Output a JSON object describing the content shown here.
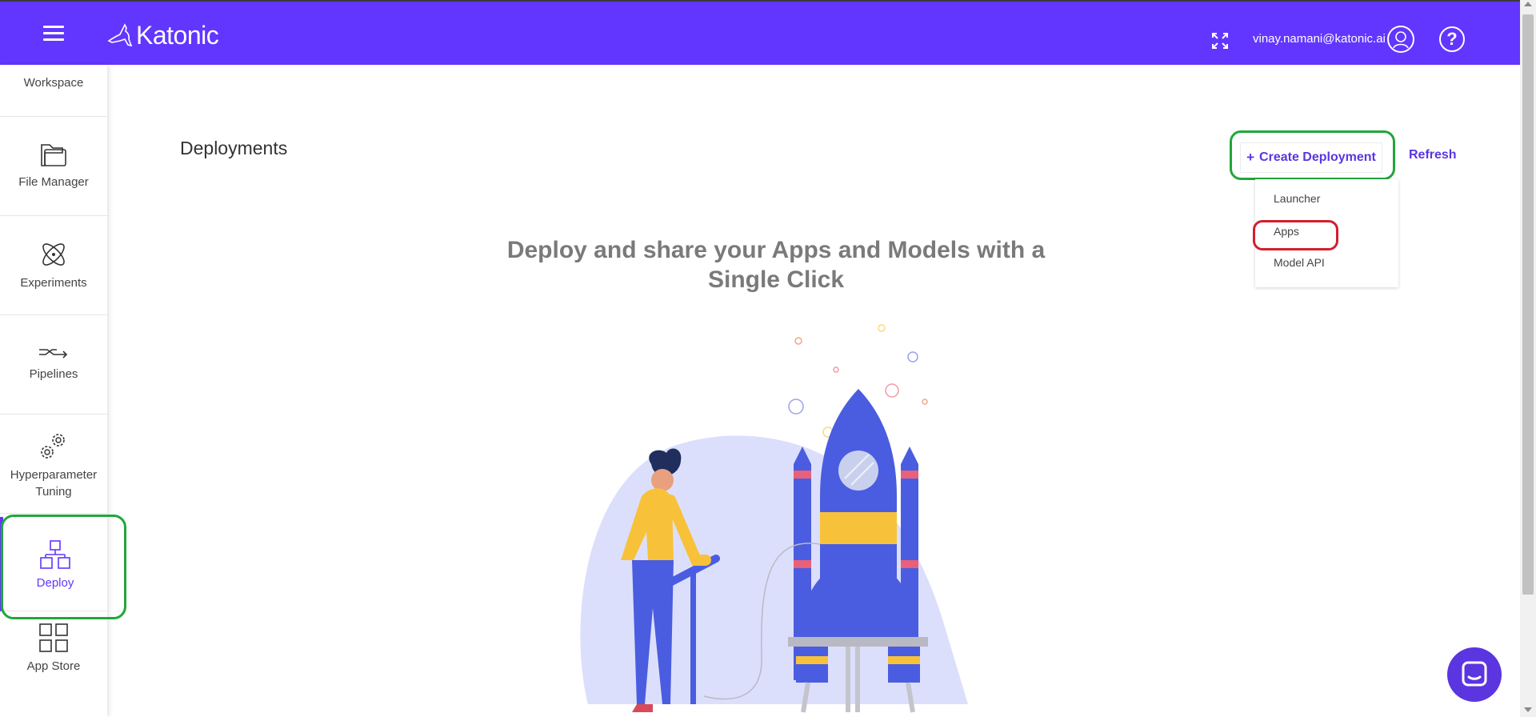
{
  "header": {
    "brand": "Katonic",
    "user_email": "vinay.namani@katonic.ai",
    "help_label": "?",
    "icons": [
      "menu-icon",
      "kangaroo-logo",
      "fullscreen-icon",
      "user-avatar-icon",
      "help-icon"
    ]
  },
  "sidebar": {
    "items": [
      {
        "label": "Workspace"
      },
      {
        "label": "File Manager",
        "icon": "folder-icon"
      },
      {
        "label": "Experiments",
        "icon": "atom-icon"
      },
      {
        "label": "Pipelines",
        "icon": "pipeline-icon"
      },
      {
        "label": "Hyperparameter Tuning",
        "icon": "gears-icon"
      },
      {
        "label": "Deploy",
        "icon": "deploy-icon",
        "active": true
      },
      {
        "label": "App Store",
        "icon": "grid-icon"
      }
    ]
  },
  "main": {
    "title": "Deployments",
    "create_button": {
      "plus": "+",
      "label": "Create Deployment"
    },
    "refresh_label": "Refresh",
    "dropdown": [
      "Launcher",
      "Apps",
      "Model API"
    ],
    "hero_line1": "Deploy and share your Apps and Models with a",
    "hero_line2": "Single Click"
  },
  "colors": {
    "brand": "#6236ff",
    "accent_text": "#5b35e0",
    "annotation_green": "#22a63b",
    "annotation_red": "#d21f2b"
  }
}
